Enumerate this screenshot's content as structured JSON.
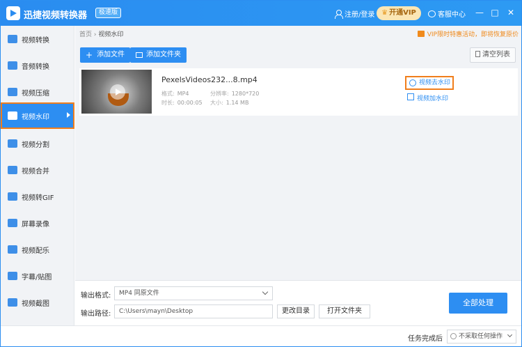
{
  "app": {
    "title": "迅捷视频转换器",
    "badge": "极速版"
  },
  "header": {
    "login": "注册/登录",
    "vip": "开通VIP",
    "service": "客服中心",
    "minimize": "—",
    "maximize": "□",
    "close": "✕"
  },
  "sidebar": {
    "items": [
      {
        "label": "视频转换"
      },
      {
        "label": "音频转换"
      },
      {
        "label": "视频压缩"
      },
      {
        "label": "视频水印"
      },
      {
        "label": "视频分割"
      },
      {
        "label": "视频合并"
      },
      {
        "label": "视频转GIF"
      },
      {
        "label": "屏幕录像"
      },
      {
        "label": "视频配乐"
      },
      {
        "label": "字幕/贴图"
      },
      {
        "label": "视频截图"
      }
    ]
  },
  "breadcrumb": {
    "home": "首页",
    "sep": "›",
    "current": "视频水印"
  },
  "promo": "VIP限时特惠活动，即将恢复原价",
  "toolbar": {
    "add_file": "添加文件",
    "add_folder": "添加文件夹",
    "clear": "清空列表"
  },
  "file": {
    "name": "PexelsVideos232...8.mp4",
    "format_label": "格式:",
    "format": "MP4",
    "resolution_label": "分辨率:",
    "resolution": "1280*720",
    "duration_label": "时长:",
    "duration": "00:00:05",
    "size_label": "大小:",
    "size": "1.14 MB",
    "remove_watermark": "视频去水印",
    "add_watermark": "视频加水印"
  },
  "output": {
    "format_label": "输出格式:",
    "format_value": "MP4  同原文件",
    "path_label": "输出路径:",
    "path_value": "C:\\Users\\mayn\\Desktop",
    "change_dir": "更改目录",
    "open_folder": "打开文件夹",
    "process_all": "全部处理"
  },
  "status": {
    "label": "任务完成后",
    "value": "不采取任何操作"
  }
}
